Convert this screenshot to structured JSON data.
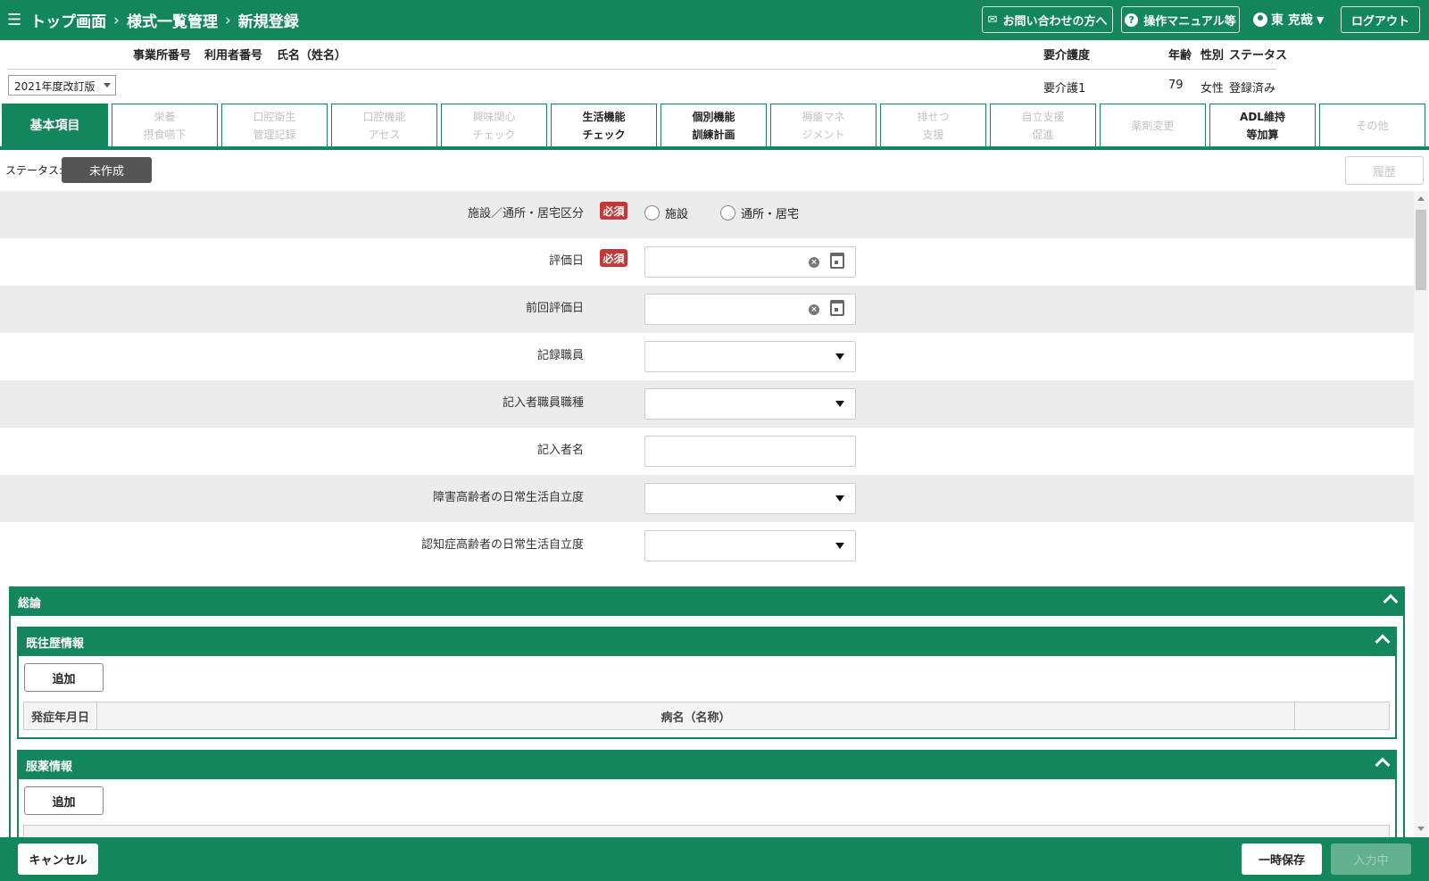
{
  "header": {
    "breadcrumb": [
      "トップ画面",
      "様式一覧管理",
      "新規登録"
    ],
    "separator": "›",
    "contact_label": "お問い合わせの方へ",
    "manual_label": "操作マニュアル等",
    "user_name": "東 克哉",
    "logout_label": "ログアウト"
  },
  "info": {
    "headers": {
      "office_no": "事業所番号",
      "user_no": "利用者番号",
      "name": "氏名（姓名）",
      "care_level": "要介護度",
      "age": "年齢",
      "gender": "性別",
      "status": "ステータス"
    },
    "values": {
      "care_level": "要介護1",
      "age": "79",
      "gender": "女性",
      "status": "登録済み"
    },
    "version_select": "2021年度改訂版"
  },
  "tabs": [
    {
      "line1": "基本項目",
      "line2": "",
      "state": "active"
    },
    {
      "line1": "栄養",
      "line2": "摂食嚥下",
      "state": "disabled"
    },
    {
      "line1": "口腔衛生",
      "line2": "管理記録",
      "state": "disabled"
    },
    {
      "line1": "口腔機能",
      "line2": "アセス",
      "state": "disabled"
    },
    {
      "line1": "興味関心",
      "line2": "チェック",
      "state": "disabled"
    },
    {
      "line1": "生活機能",
      "line2": "チェック",
      "state": "enabled"
    },
    {
      "line1": "個別機能",
      "line2": "訓練計画",
      "state": "enabled"
    },
    {
      "line1": "褥瘡マネ",
      "line2": "ジメント",
      "state": "disabled"
    },
    {
      "line1": "排せつ",
      "line2": "支援",
      "state": "disabled"
    },
    {
      "line1": "自立支援",
      "line2": "促進",
      "state": "disabled"
    },
    {
      "line1": "薬剤変更",
      "line2": "",
      "state": "disabled"
    },
    {
      "line1": "ADL維持",
      "line2": "等加算",
      "state": "enabled"
    },
    {
      "line1": "その他",
      "line2": "",
      "state": "disabled"
    }
  ],
  "status": {
    "label": "ステータス:",
    "value": "未作成",
    "history_label": "履歴"
  },
  "form": {
    "required_label": "必須",
    "facility_type": {
      "label": "施設／通所・居宅区分",
      "options": [
        "施設",
        "通所・居宅"
      ]
    },
    "eval_date": {
      "label": "評価日",
      "value": ""
    },
    "prev_eval_date": {
      "label": "前回評価日",
      "value": ""
    },
    "recorder": {
      "label": "記録職員",
      "value": ""
    },
    "writer_job": {
      "label": "記入者職員職種",
      "value": ""
    },
    "writer_name": {
      "label": "記入者名",
      "value": ""
    },
    "elderly_disability": {
      "label": "障害高齢者の日常生活自立度",
      "value": ""
    },
    "dementia_level": {
      "label": "認知症高齢者の日常生活自立度",
      "value": ""
    }
  },
  "sections": {
    "general": {
      "title": "総論"
    },
    "history": {
      "title": "既往歴情報",
      "add_label": "追加",
      "columns": [
        "発症年月日",
        "病名（名称）",
        ""
      ]
    },
    "medication": {
      "title": "服薬情報",
      "add_label": "追加"
    }
  },
  "footer": {
    "cancel_label": "キャンセル",
    "temp_save_label": "一時保存",
    "submit_label": "入力中"
  }
}
